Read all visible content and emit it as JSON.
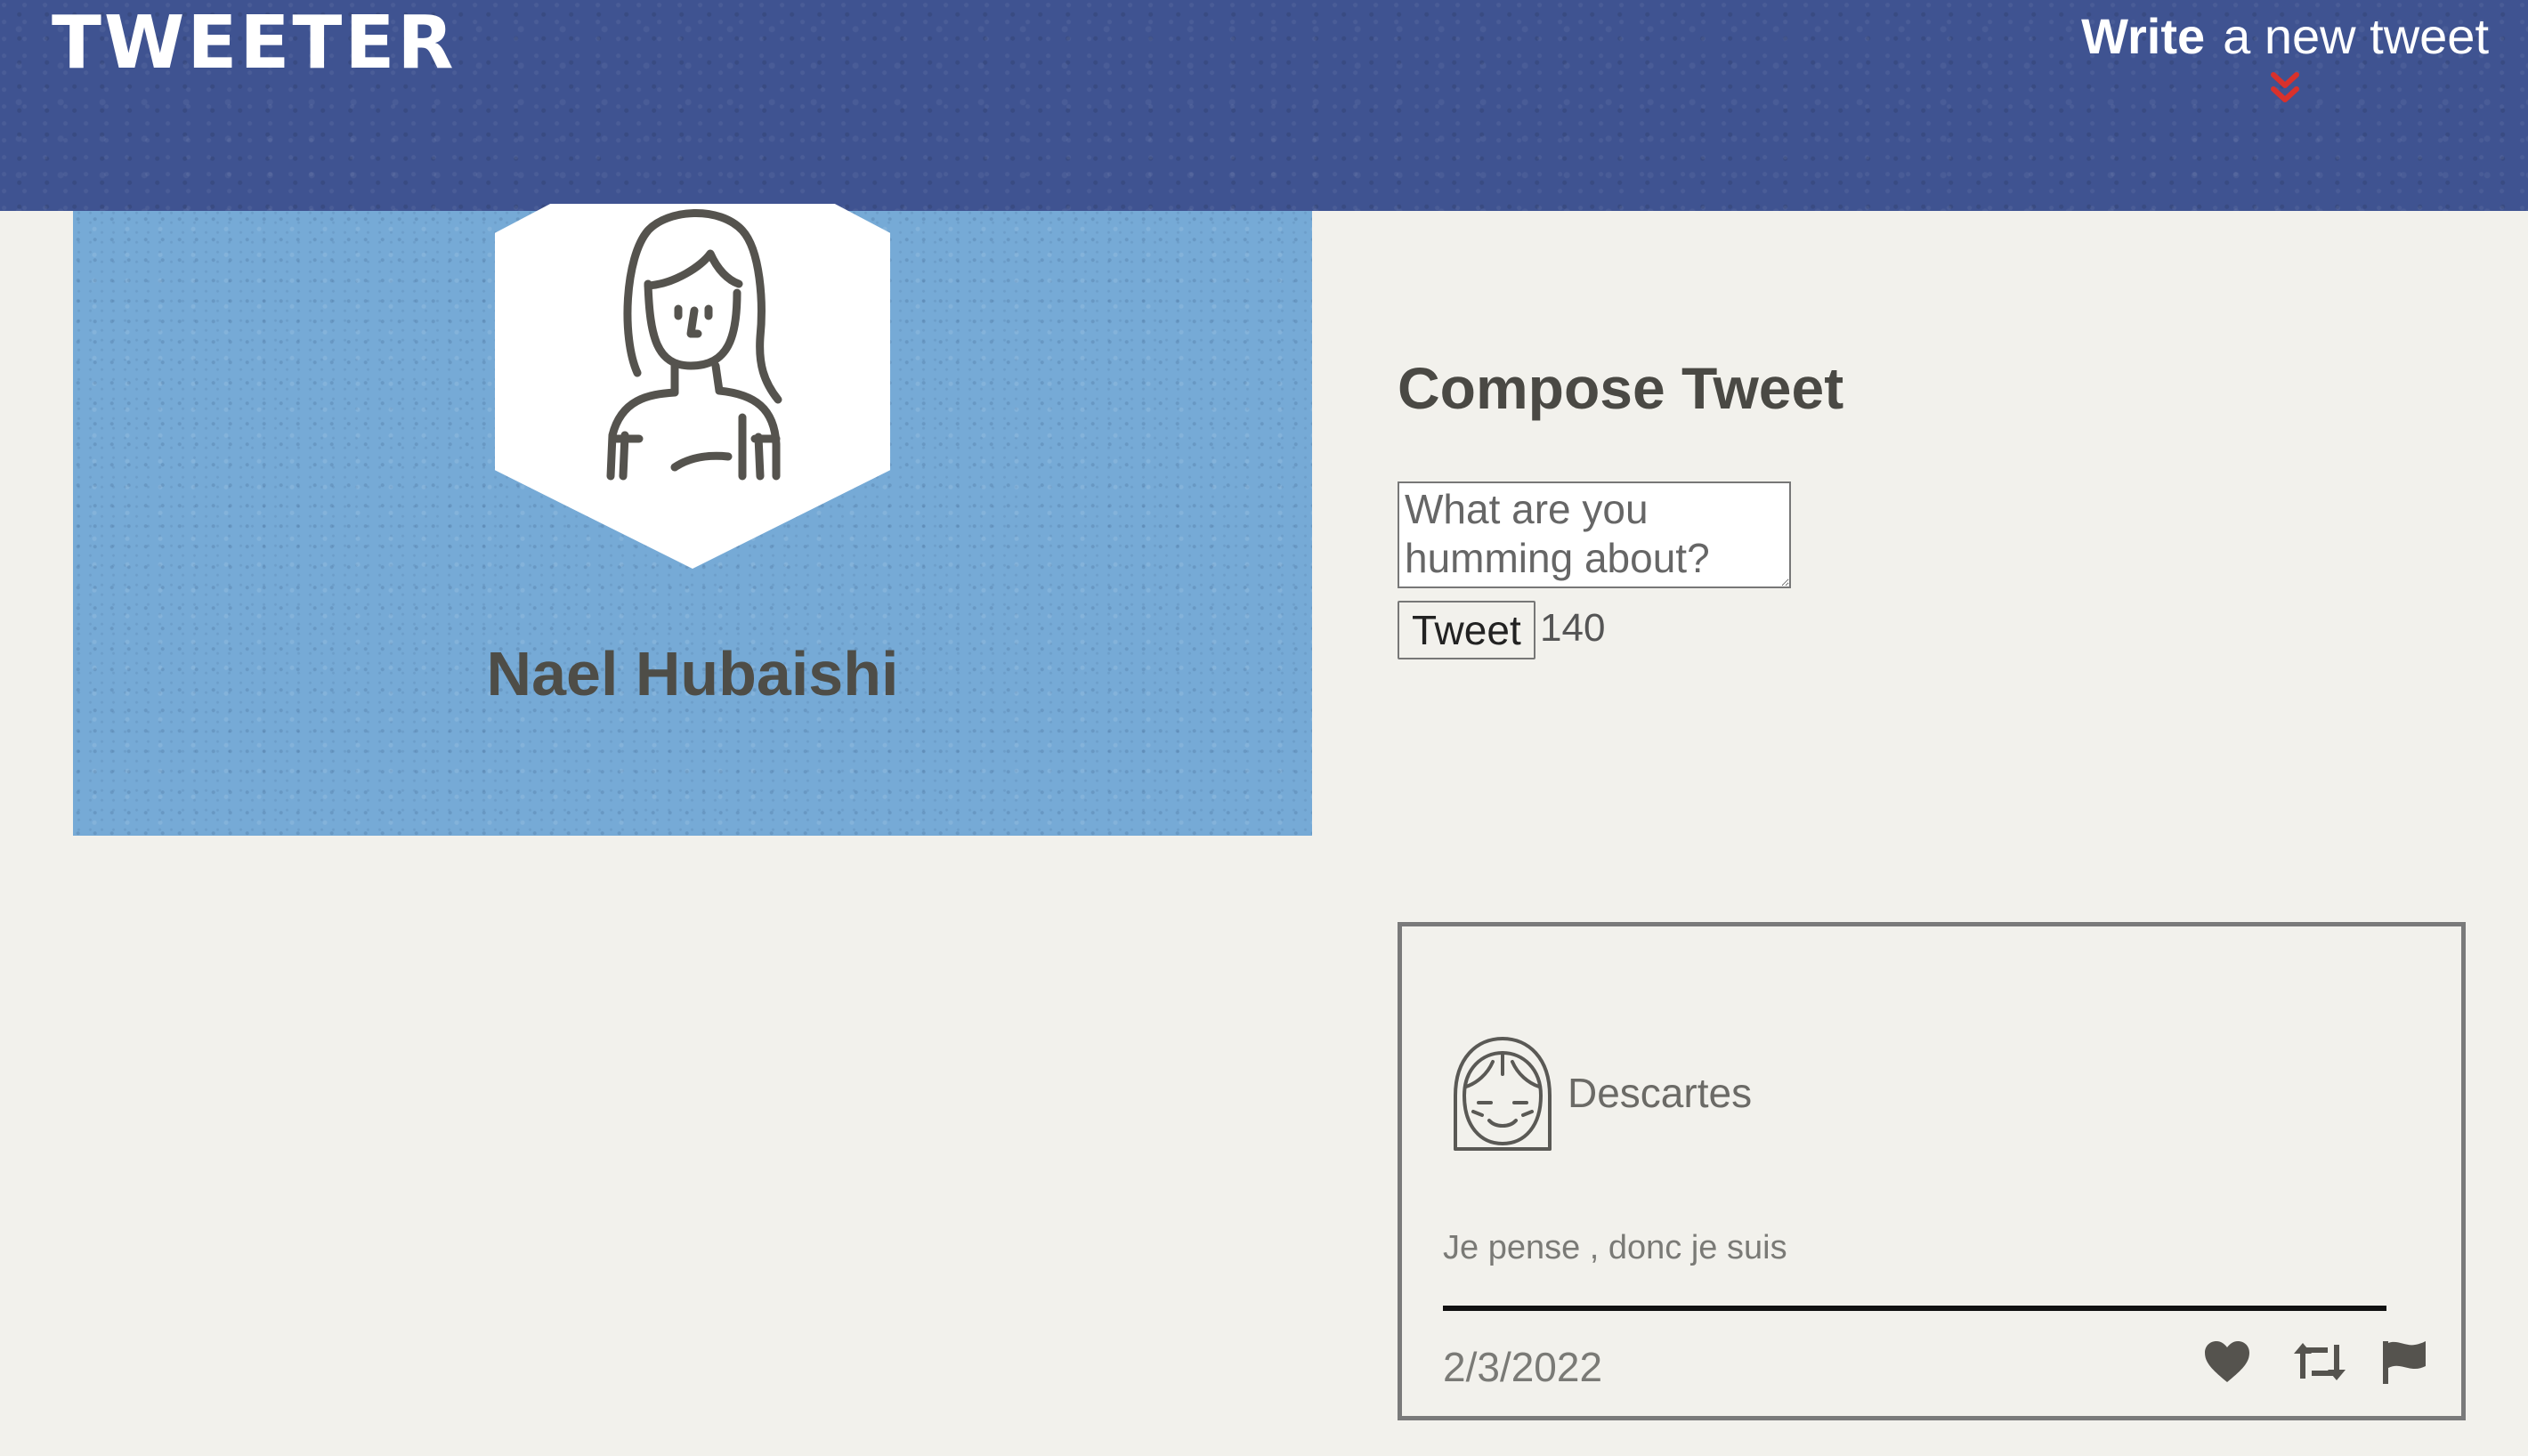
{
  "nav": {
    "brand": "TWEETER",
    "compose_toggle": {
      "bold": "Write",
      "rest": "a new tweet"
    },
    "toggle_icon": "double-chevron-down-icon",
    "colors": {
      "bar": "#3f5391",
      "chevron": "#d9312b"
    }
  },
  "profile": {
    "name": "Nael Hubaishi",
    "avatar_icon": "user-avatar-icon",
    "banner_color": "#76aad6"
  },
  "compose": {
    "title": "Compose Tweet",
    "placeholder": "What are you humming about?",
    "button_label": "Tweet",
    "counter": "140"
  },
  "tweets": [
    {
      "user": "Descartes",
      "text": "Je pense , donc je suis",
      "date": "2/3/2022",
      "actions": [
        "heart-icon",
        "retweet-icon",
        "flag-icon"
      ]
    }
  ]
}
